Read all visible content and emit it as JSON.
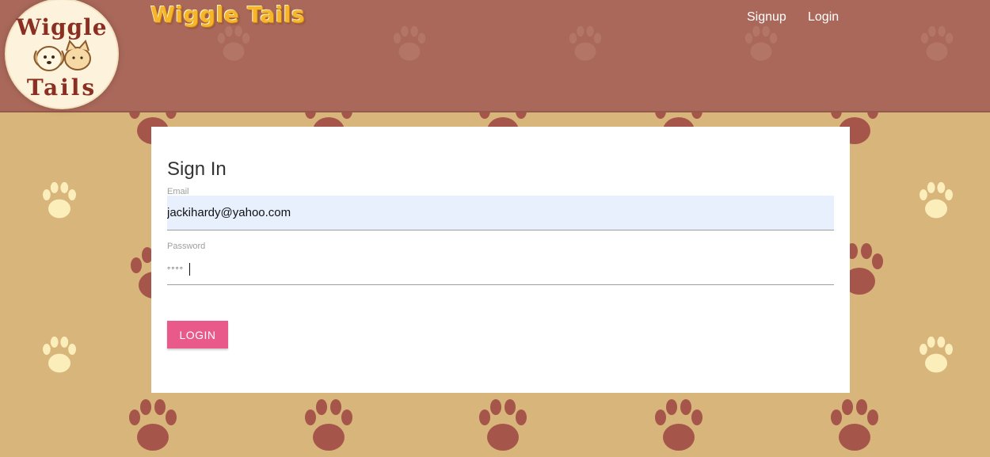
{
  "colors": {
    "header_bg": "#a9685a",
    "page_bg": "#d8b57a",
    "paw_dark": "#a6554a",
    "paw_light": "#fbeebb",
    "brand": "#f6b52a",
    "button": "#e95a8a",
    "email_bg": "#e8f0fe"
  },
  "logo": {
    "line1": "Wiggle",
    "line2": "Tails"
  },
  "header": {
    "brand": "Wiggle Tails"
  },
  "nav": {
    "signup": "Signup",
    "login": "Login"
  },
  "form": {
    "title": "Sign In",
    "email_label": "Email",
    "email_value": "jackihardy@yahoo.com",
    "password_label": "Password",
    "password_value": "◦◦◦◦",
    "submit": "LOGIN"
  }
}
